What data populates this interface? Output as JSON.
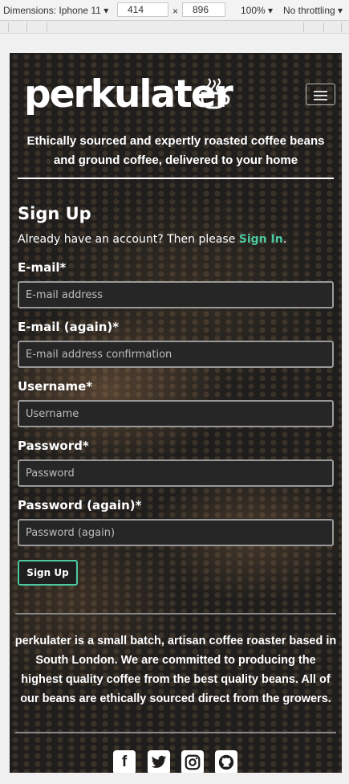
{
  "devtools": {
    "device": "Dimensions: Iphone 11",
    "width": "414",
    "height": "896",
    "times": "×",
    "zoom": "100%",
    "throttling": "No throttling"
  },
  "header": {
    "logo": "perkulater",
    "tagline": "Ethically sourced and expertly roasted coffee beans and ground coffee, delivered to your home"
  },
  "signup": {
    "title": "Sign Up",
    "prompt": "Already have an account? Then please",
    "signin_link": "Sign In",
    "period": ".",
    "fields": [
      {
        "label": "E-mail*",
        "placeholder": "E-mail address"
      },
      {
        "label": "E-mail (again)*",
        "placeholder": "E-mail address confirmation"
      },
      {
        "label": "Username*",
        "placeholder": "Username"
      },
      {
        "label": "Password*",
        "placeholder": "Password"
      },
      {
        "label": "Password (again)*",
        "placeholder": "Password (again)"
      }
    ],
    "button": "Sign Up"
  },
  "footer": {
    "about": "perkulater is a small batch, artisan coffee roaster based in South London. We are committed to producing the highest quality coffee from the best quality beans. All of our beans are ethically sourced direct from the growers.",
    "socials": [
      {
        "icon": "facebook-icon"
      },
      {
        "icon": "twitter-icon"
      },
      {
        "icon": "instagram-icon"
      },
      {
        "icon": "github-icon"
      }
    ]
  },
  "colors": {
    "accent": "#4cc9a0",
    "background": "#1f1e1c"
  }
}
